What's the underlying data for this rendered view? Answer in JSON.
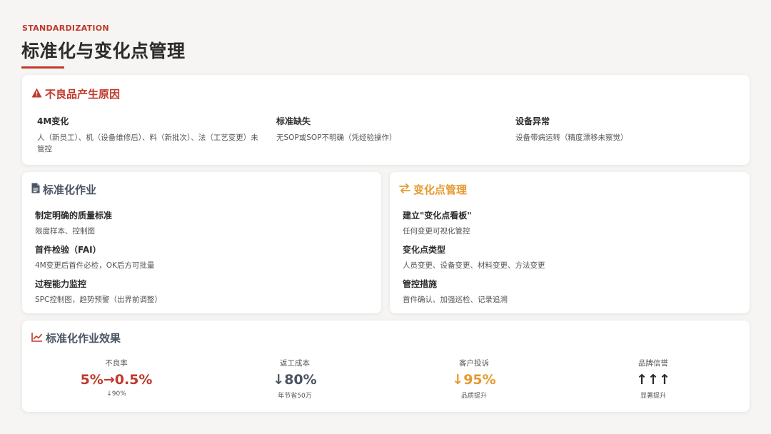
{
  "header": {
    "eyebrow": "STANDARDIZATION",
    "title": "标准化与变化点管理"
  },
  "causes": {
    "title": "不良品产生原因",
    "icon": "warning-icon",
    "items": [
      {
        "title": "4M变化",
        "desc": "人（新员工）、机（设备维修后）、料（新批次）、法（工艺变更）未管控"
      },
      {
        "title": "标准缺失",
        "desc": "无SOP或SOP不明确（凭经验操作）"
      },
      {
        "title": "设备异常",
        "desc": "设备带病运转（精度漂移未察觉）"
      }
    ]
  },
  "standard": {
    "title": "标准化作业",
    "icon": "document-icon",
    "items": [
      {
        "title": "制定明确的质量标准",
        "desc": "限度样本、控制图"
      },
      {
        "title": "首件检验（FAI）",
        "desc": "4M变更后首件必检，OK后方可批量"
      },
      {
        "title": "过程能力监控",
        "desc": "SPC控制图，趋势预警（出界前调整）"
      }
    ]
  },
  "change": {
    "title": "变化点管理",
    "icon": "exchange-icon",
    "items": [
      {
        "title": "建立\"变化点看板\"",
        "desc": "任何变更可视化管控"
      },
      {
        "title": "变化点类型",
        "desc": "人员变更、设备变更、材料变更、方法变更"
      },
      {
        "title": "管控措施",
        "desc": "首件确认、加强巡检、记录追溯"
      }
    ]
  },
  "effect": {
    "title": "标准化作业效果",
    "icon": "chart-line-icon",
    "metrics": [
      {
        "label": "不良率",
        "value": "5%→0.5%",
        "note": "↓90%",
        "color": "#c0392b"
      },
      {
        "label": "返工成本",
        "value": "↓80%",
        "note": "年节省50万",
        "color": "#4a5462"
      },
      {
        "label": "客户投诉",
        "value": "↓95%",
        "note": "品质提升",
        "color": "#e59a2f"
      },
      {
        "label": "品牌信誉",
        "value": "↑↑↑",
        "note": "显著提升",
        "color": "#2b2b2b"
      }
    ]
  },
  "colors": {
    "accent_red": "#c0392b",
    "accent_orange": "#e59a2f",
    "slate": "#4a5462"
  }
}
